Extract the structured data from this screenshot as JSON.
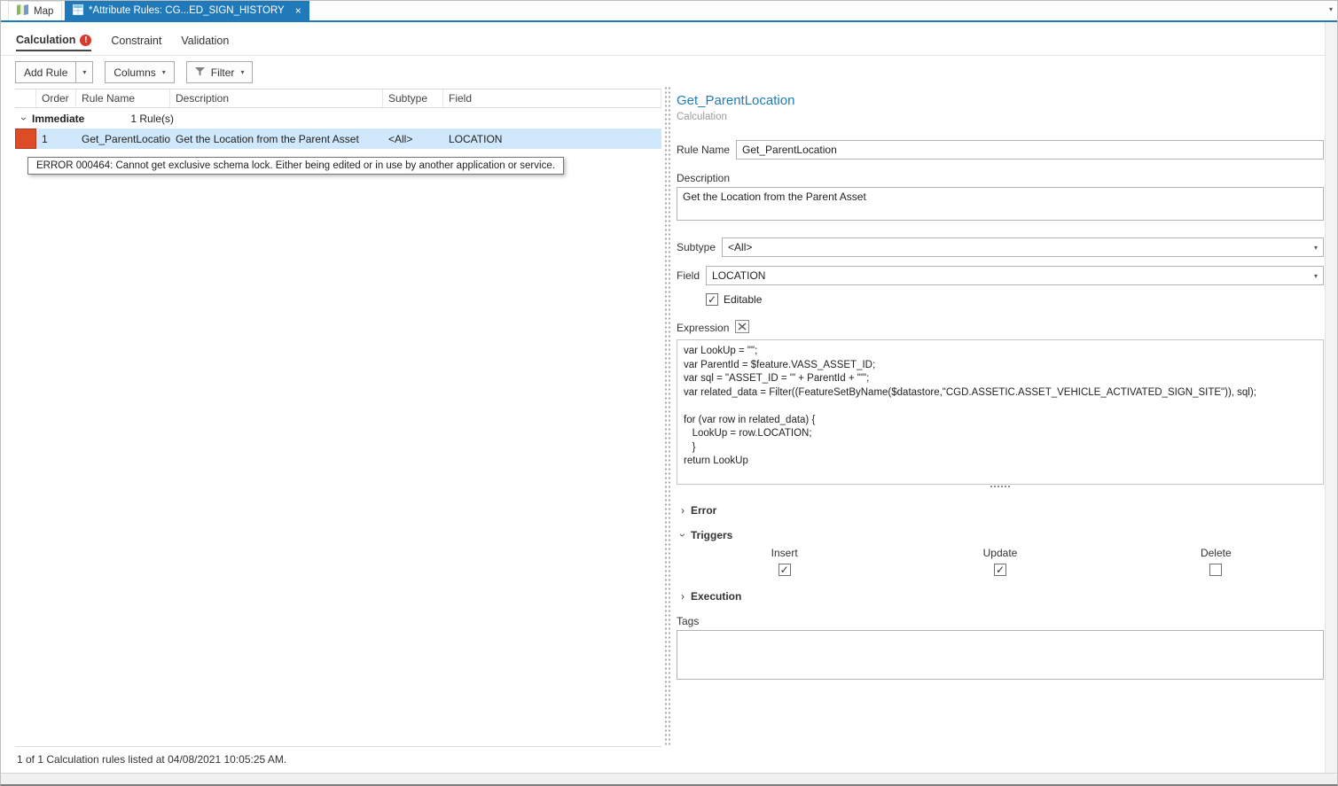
{
  "icons": {
    "caret_down": "▾",
    "close": "×",
    "chevron": "›",
    "check": "✓",
    "badge": "!"
  },
  "tabs": {
    "map": "Map",
    "attribute_rules": "*Attribute Rules: CG...ED_SIGN_HISTORY"
  },
  "subtabs": {
    "calculation": "Calculation",
    "constraint": "Constraint",
    "validation": "Validation"
  },
  "toolbar": {
    "add_rule": "Add Rule",
    "columns": "Columns",
    "filter": "Filter"
  },
  "table": {
    "headers": {
      "order": "Order",
      "rule_name": "Rule Name",
      "description": "Description",
      "subtype": "Subtype",
      "field": "Field"
    },
    "group": {
      "name": "Immediate",
      "count": "1 Rule(s)"
    },
    "row": {
      "order": "1",
      "rule_name": "Get_ParentLocation",
      "description": "Get the Location from the Parent Asset",
      "subtype": "<All>",
      "field": "LOCATION"
    },
    "status": "1 of 1 Calculation rules listed at 04/08/2021 10:05:25 AM."
  },
  "error_tooltip": "ERROR 000464: Cannot get exclusive schema lock.  Either being edited or in use by another application or service.",
  "details": {
    "title": "Get_ParentLocation",
    "subtitle": "Calculation",
    "labels": {
      "rule_name": "Rule Name",
      "description": "Description",
      "subtype": "Subtype",
      "field": "Field",
      "editable": "Editable",
      "expression": "Expression",
      "tags": "Tags"
    },
    "values": {
      "rule_name": "Get_ParentLocation",
      "description": "Get the Location from the Parent Asset",
      "subtype": "<All>",
      "field": "LOCATION",
      "editable_checked": true,
      "tags": ""
    },
    "expression_code": "var LookUp = \"\";\nvar ParentId = $feature.VASS_ASSET_ID;\nvar sql = \"ASSET_ID = '\" + ParentId + \"'\";\nvar related_data = Filter((FeatureSetByName($datastore,\"CGD.ASSETIC.ASSET_VEHICLE_ACTIVATED_SIGN_SITE\")), sql);\n\nfor (var row in related_data) {\n   LookUp = row.LOCATION;\n   }\nreturn LookUp",
    "sections": {
      "error": "Error",
      "triggers": "Triggers",
      "execution": "Execution"
    },
    "triggers": [
      {
        "label": "Insert",
        "checked": true
      },
      {
        "label": "Update",
        "checked": true
      },
      {
        "label": "Delete",
        "checked": false
      }
    ]
  },
  "colors": {
    "accent": "#2079b8",
    "selection": "#cfe8fb",
    "error_indicator": "#dd4b27",
    "error_badge": "#d83b2e"
  }
}
